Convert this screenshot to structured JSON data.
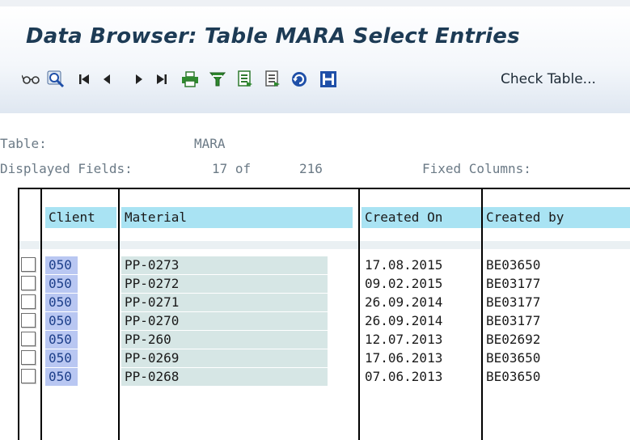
{
  "window": {
    "title": "Data Browser: Table MARA Select Entries"
  },
  "toolbar": {
    "icons": [
      "glasses-icon",
      "refresh-search-icon",
      "first-page-icon",
      "previous-page-icon",
      "next-page-icon",
      "last-page-icon",
      "print-icon",
      "filter-icon",
      "export-icon",
      "export-list-icon",
      "refresh-icon",
      "info-icon"
    ],
    "check_table_label": "Check Table..."
  },
  "meta": {
    "table_label": "Table:",
    "table_value": "MARA",
    "displayed_label": "Displayed Fields:",
    "displayed_value": "17 of",
    "displayed_total": "216",
    "fixed_label": "Fixed Columns:"
  },
  "columns": {
    "client": "Client",
    "material": "Material",
    "created_on": "Created On",
    "created_by": "Created by"
  },
  "rows": [
    {
      "client": "050",
      "material": "PP-0273",
      "created_on": "17.08.2015",
      "created_by": "BE03650"
    },
    {
      "client": "050",
      "material": "PP-0272",
      "created_on": "09.02.2015",
      "created_by": "BE03177"
    },
    {
      "client": "050",
      "material": "PP-0271",
      "created_on": "26.09.2014",
      "created_by": "BE03177"
    },
    {
      "client": "050",
      "material": "PP-0270",
      "created_on": "26.09.2014",
      "created_by": "BE03177"
    },
    {
      "client": "050",
      "material": "PP-260",
      "created_on": "12.07.2013",
      "created_by": "BE02692"
    },
    {
      "client": "050",
      "material": "PP-0269",
      "created_on": "17.06.2013",
      "created_by": "BE03650"
    },
    {
      "client": "050",
      "material": "PP-0268",
      "created_on": "07.06.2013",
      "created_by": "BE03650"
    }
  ],
  "colors": {
    "title": "#1d3b55",
    "header_bg": "#a9e3f3",
    "client_cell": "#b9c7f2",
    "material_cell": "#d6e6e5",
    "icon_blue": "#1f4fa8",
    "icon_green": "#2f8a2f"
  }
}
